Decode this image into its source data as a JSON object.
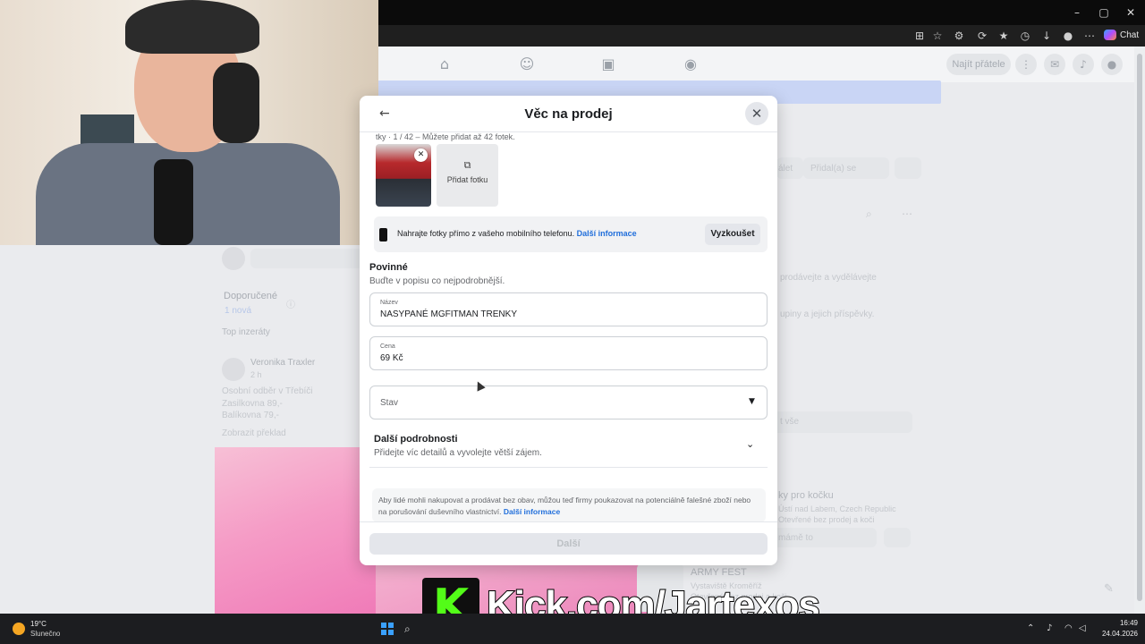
{
  "dialog": {
    "title": "Věc na prodej",
    "photo_info": "tky · 1 / 42 – Můžete přidat až 42 fotek.",
    "add_photo_label": "Přidat fotku",
    "phone_banner": {
      "text": "Nahrajte fotky přímo z vašeho mobilního telefonu.",
      "link": "Další informace",
      "button": "Vyzkoušet"
    },
    "required": {
      "title": "Povinné",
      "subtitle": "Buďte v popisu co nejpodrobnější."
    },
    "fields": {
      "name_label": "Název",
      "name_value": "NASYPANÉ MGFITMAN TRENKY",
      "price_label": "Cena",
      "price_value": "69 Kč",
      "state_label": "Stav"
    },
    "more_details": {
      "title": "Další podrobnosti",
      "subtitle": "Přidejte víc detailů a vyvolejte větší zájem."
    },
    "legal": {
      "text": "Aby lidé mohli nakupovat a prodávat bez obav, můžou teď firmy poukazovat na potenciálně falešné zboží nebo na porušování duševního vlastnictví.",
      "link": "Další informace"
    },
    "next_button": "Další"
  },
  "background": {
    "find_friends": "Najít přátele",
    "recommended": "Doporučené",
    "recommended_new": "1 nová",
    "top_listings": "Top inzeráty",
    "seller_name": "Veronika Traxler",
    "seller_time": "2 h",
    "listing_lines": [
      "Osobní odběr v Třebíči",
      "Zasilkovna 89,-",
      "Balíkovna 79,-"
    ],
    "translate": "Zobrazit překlad",
    "right_add": "Přidal(a) se",
    "right_btn": "álet",
    "right_text1": "prodávejte a vydělávejte",
    "right_text2": "upiny a jejich příspěvky.",
    "right_show": "t vše",
    "right_cat": "ky pro kočku",
    "right_loc": "Ústí nad Labem, Czech Republic",
    "right_sub": "Otevřené bez prodej a koči",
    "right_input": "mámě to",
    "right_event": "ARMY FEST",
    "right_event_loc": "Vystaviště Kroměříž",
    "right_event_sub": "Otevřené bez prodej a koči"
  },
  "browser": {
    "chat_label": "Chat"
  },
  "watermark": {
    "text": "Kick.com/Jartexos",
    "logo_letter": "K"
  },
  "taskbar": {
    "weather_temp": "19°C",
    "weather_desc": "Slunečno",
    "time": "16:49",
    "date": "24.04.2026"
  },
  "colors": {
    "fb_blue": "#216fdb",
    "kick_green": "#53fc18",
    "dialog_bg": "#ffffff"
  }
}
